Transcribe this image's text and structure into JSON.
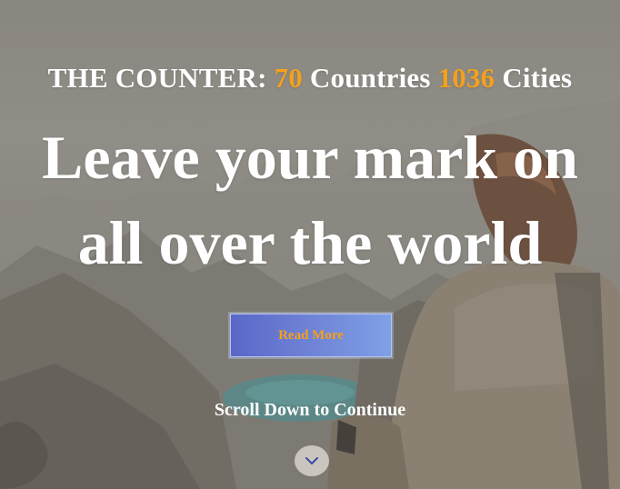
{
  "counter": {
    "prefix": "THE COUNTER: ",
    "countries_value": "70",
    "countries_label": " Countries ",
    "cities_value": "1036",
    "cities_label": " Cities"
  },
  "headline": {
    "line1": "Leave your mark on",
    "line2": "all over the world"
  },
  "cta": {
    "read_more_label": "Read More"
  },
  "scroll": {
    "text": "Scroll Down to Continue",
    "icon": "chevron-down-icon"
  },
  "colors": {
    "accent": "#f5a01c",
    "button_gradient_start": "#5a67c8",
    "button_gradient_end": "#7fa0e6",
    "chevron": "#3d4aa8"
  }
}
